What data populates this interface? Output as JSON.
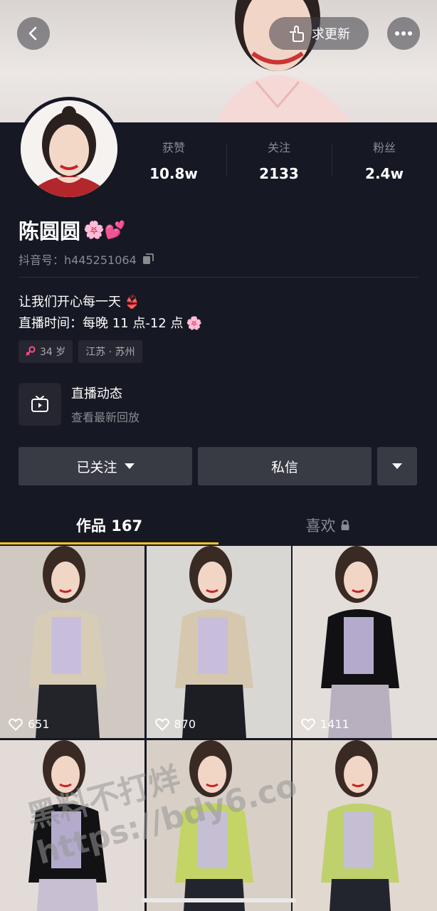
{
  "header": {
    "update_label": "求更新",
    "icons": {
      "back": "chevron-left-icon",
      "more": "more-dots-icon",
      "update": "hand-point-icon"
    }
  },
  "stats": [
    {
      "label": "获赞",
      "value": "10.8w"
    },
    {
      "label": "关注",
      "value": "2133"
    },
    {
      "label": "粉丝",
      "value": "2.4w"
    }
  ],
  "profile": {
    "name": "陈圆圆",
    "name_emoji": "🌸💕",
    "douyin_id": "抖音号：h445251064",
    "bio": [
      {
        "text": "让我们开心每一天",
        "emoji": "👙"
      },
      {
        "text": "直播时间：每晚 11 点-12 点",
        "emoji": "🌸"
      }
    ],
    "tags": [
      {
        "icon": "female-icon",
        "text": "34 岁"
      },
      {
        "text": "江苏 · 苏州"
      }
    ]
  },
  "live": {
    "title": "直播动态",
    "subtitle": "查看最新回放"
  },
  "actions": {
    "follow": "已关注",
    "message": "私信"
  },
  "tabs": {
    "works": "作品 167",
    "likes": "喜欢"
  },
  "videos": [
    {
      "likes": "651",
      "bg": "#cfc9c1",
      "top": "#d7cdb6",
      "pants": "#22242a"
    },
    {
      "likes": "870",
      "bg": "#d9d7d4",
      "top": "#d6c8af",
      "pants": "#1d1e24"
    },
    {
      "likes": "1411",
      "bg": "#e4dedb",
      "top": "#111114",
      "pants": "#b9b0bf"
    },
    {
      "likes": "",
      "bg": "#e2dbd7",
      "top": "#121215",
      "pants": "#c8bfd2"
    },
    {
      "likes": "",
      "bg": "#d8cfc6",
      "top": "#c4d466",
      "pants": "#23252e"
    },
    {
      "likes": "",
      "bg": "#e1d8d0",
      "top": "#bfd16c",
      "pants": "#23252e"
    }
  ],
  "watermark": {
    "line1": "黑料不打烊",
    "line2": "https://bdy6.co"
  },
  "colors": {
    "background": "#161823",
    "tab_underline": "#f9c623",
    "button": "#393b44"
  }
}
